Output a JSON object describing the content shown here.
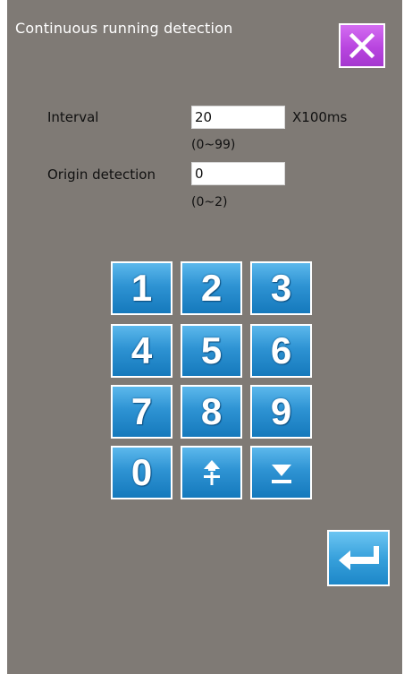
{
  "window": {
    "title": "Continuous running detection"
  },
  "icons": {
    "close": "close-icon",
    "enter": "enter-icon",
    "shift": "shift-icon",
    "down": "down-icon"
  },
  "colors": {
    "panel": "#7f7a75",
    "key_blue": "#2e93d3",
    "close_purple": "#b845df"
  },
  "form": {
    "interval": {
      "label": "Interval",
      "value": "20",
      "unit": "X100ms",
      "range": "(0~99)"
    },
    "origin": {
      "label": "Origin detection",
      "value": "0",
      "range": "(0~2)"
    }
  },
  "keypad": {
    "keys": [
      "1",
      "2",
      "3",
      "4",
      "5",
      "6",
      "7",
      "8",
      "9",
      "0"
    ]
  }
}
